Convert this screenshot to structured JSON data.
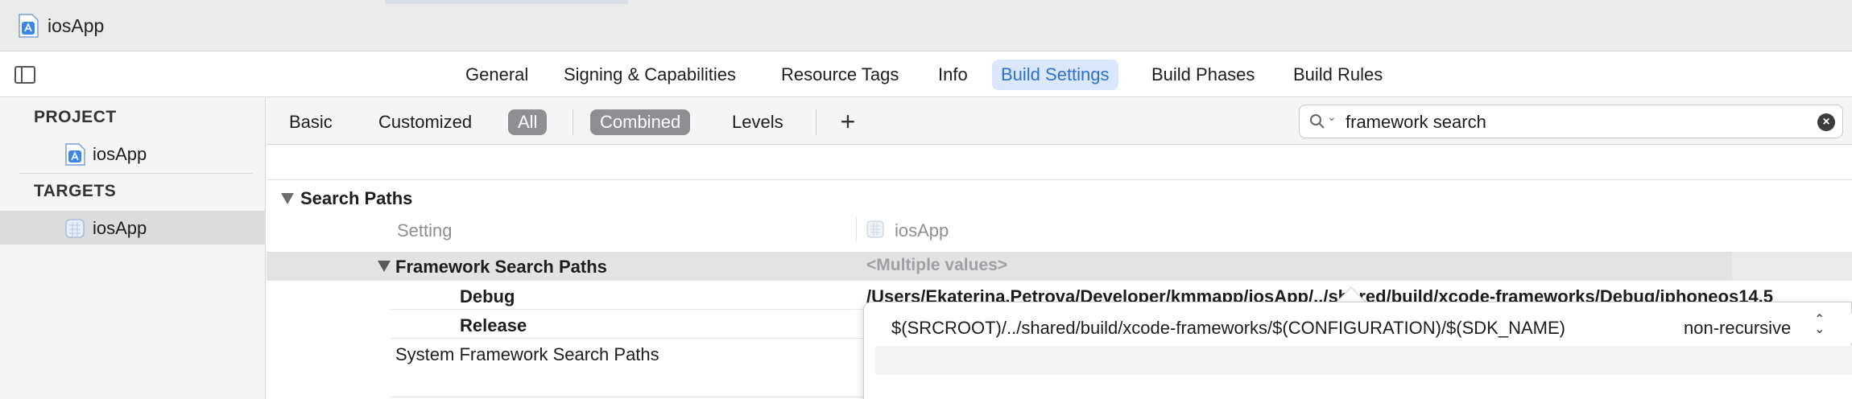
{
  "window": {
    "title": "iosApp"
  },
  "editor_tabs": [
    {
      "label": "General"
    },
    {
      "label": "Signing & Capabilities"
    },
    {
      "label": "Resource Tags"
    },
    {
      "label": "Info"
    },
    {
      "label": "Build Settings",
      "active": true
    },
    {
      "label": "Build Phases"
    },
    {
      "label": "Build Rules"
    }
  ],
  "navigator": {
    "project_header": "PROJECT",
    "project_item": "iosApp",
    "targets_header": "TARGETS",
    "target_item": "iosApp"
  },
  "filter": {
    "basic": "Basic",
    "customized": "Customized",
    "all": "All",
    "combined": "Combined",
    "levels": "Levels",
    "add": "+"
  },
  "search": {
    "value": "framework search"
  },
  "settings": {
    "section": "Search Paths",
    "column_setting": "Setting",
    "column_target": "iosApp",
    "framework_search_paths": {
      "name": "Framework Search Paths",
      "value": "<Multiple values>",
      "debug_label": "Debug",
      "debug_value": "/Users/Ekaterina.Petrova/Developer/kmmapp/iosApp/../shared/build/xcode-frameworks/Debug/iphoneos14.5",
      "release_label": "Release"
    },
    "system_framework_search_paths": {
      "name": "System Framework Search Paths"
    }
  },
  "popover": {
    "path": "$(SRCROOT)/../shared/build/xcode-frameworks/$(CONFIGURATION)/$(SDK_NAME)",
    "recursive": "non-recursive"
  },
  "colors": {
    "accent": "#2b6fd6",
    "accent_bg": "#dbe7fb",
    "pill": "#8e8e93"
  }
}
